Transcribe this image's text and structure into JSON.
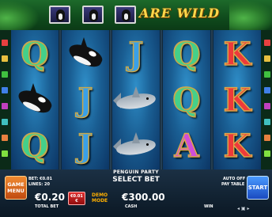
{
  "header": {
    "title": "ARE WILD",
    "portraits": [
      "penguin-portrait-1",
      "penguin-portrait-2",
      "penguin-portrait-3"
    ]
  },
  "reels": [
    [
      "Q",
      "orca",
      "Q"
    ],
    [
      "orca",
      "J",
      "J"
    ],
    [
      "J",
      "shark",
      "shark"
    ],
    [
      "Q",
      "Q",
      "A"
    ],
    [
      "K",
      "K",
      "K"
    ]
  ],
  "footer": {
    "game_name": "PENGUIN PARTY",
    "select_bet_label": "SELECT BET",
    "bet_line": "BET: €0.01",
    "lines_line": "LINES: 20",
    "auto_label": "AUTO OFF",
    "paytable_label": "PAY TABLE",
    "menu_line1": "GAME",
    "menu_line2": "MENU",
    "total_bet_value": "€0.20",
    "total_bet_label": "TOTAL BET",
    "coin_line1": "€0.01",
    "coin_line2": "€",
    "demo_line1": "DEMO",
    "demo_line2": "MODE",
    "cash_value": "€300.00",
    "cash_label": "CASH",
    "win_label": "WIN",
    "start_label": "START",
    "corner_icons": "◂ ▣ ▸"
  },
  "colors": {
    "q": "#44d08a",
    "j": "#3aa0e8",
    "k": "#ee3a3a",
    "a": "#d04ed8",
    "menu_button": "#e06a20",
    "start_button": "#2a6ae0"
  }
}
